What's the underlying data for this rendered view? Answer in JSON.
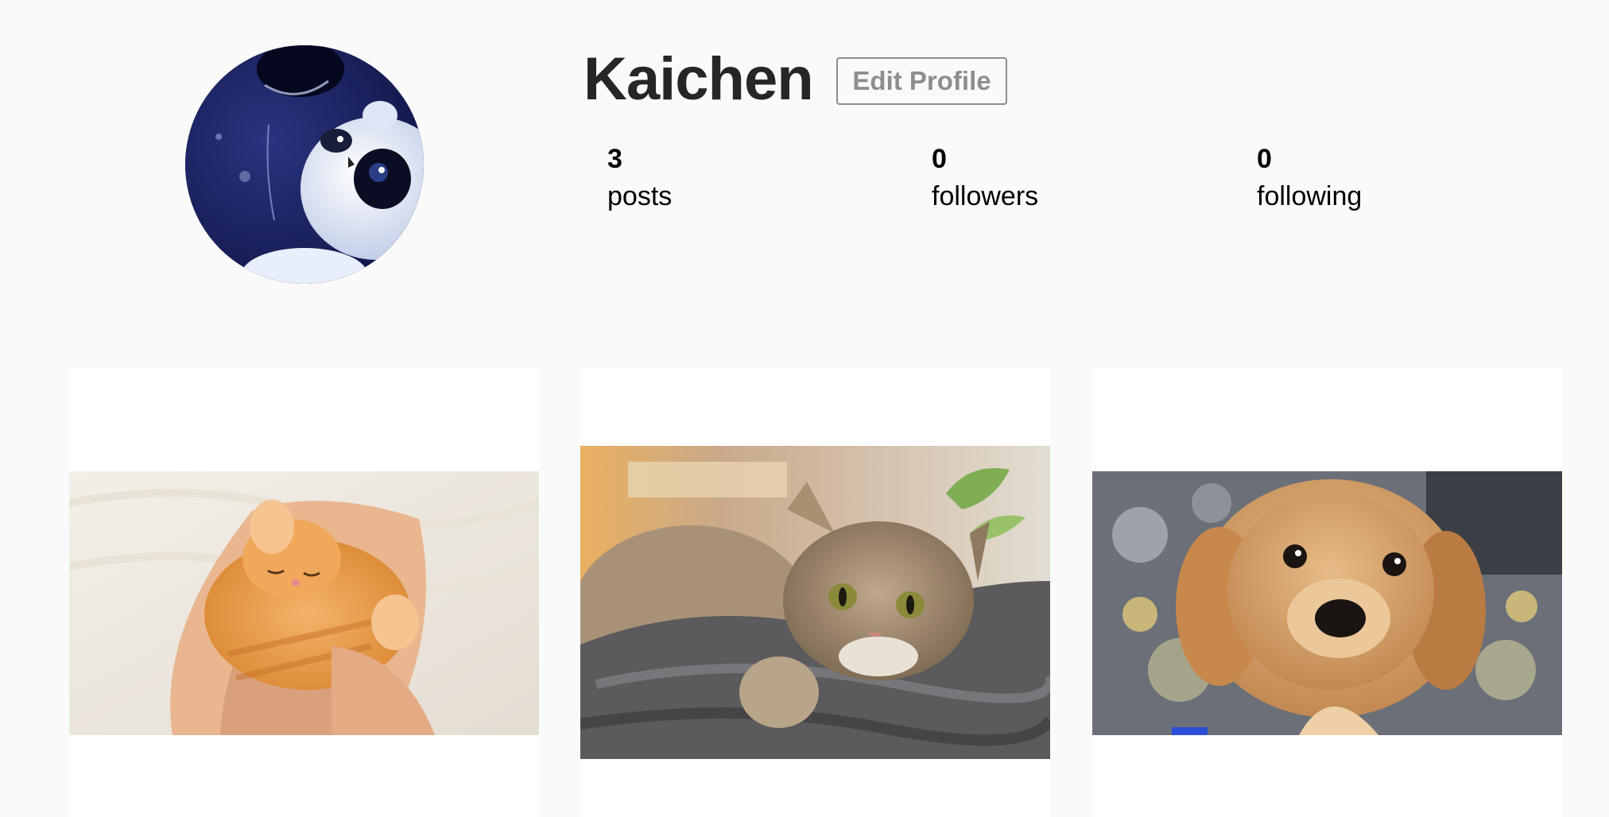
{
  "profile": {
    "username": "Kaichen",
    "edit_label": "Edit Profile",
    "avatar": "panda-avatar"
  },
  "stats": [
    {
      "count": "3",
      "label": "posts"
    },
    {
      "count": "0",
      "label": "followers"
    },
    {
      "count": "0",
      "label": "following"
    }
  ],
  "posts": [
    {
      "image": "sleeping-orange-kitten-in-hands"
    },
    {
      "image": "tabby-cat-on-gray-blanket"
    },
    {
      "image": "golden-retriever-puppy"
    }
  ],
  "colors": {
    "background": "#fafafa",
    "text": "#262626",
    "muted": "#8e8e8e",
    "card": "#ffffff"
  }
}
